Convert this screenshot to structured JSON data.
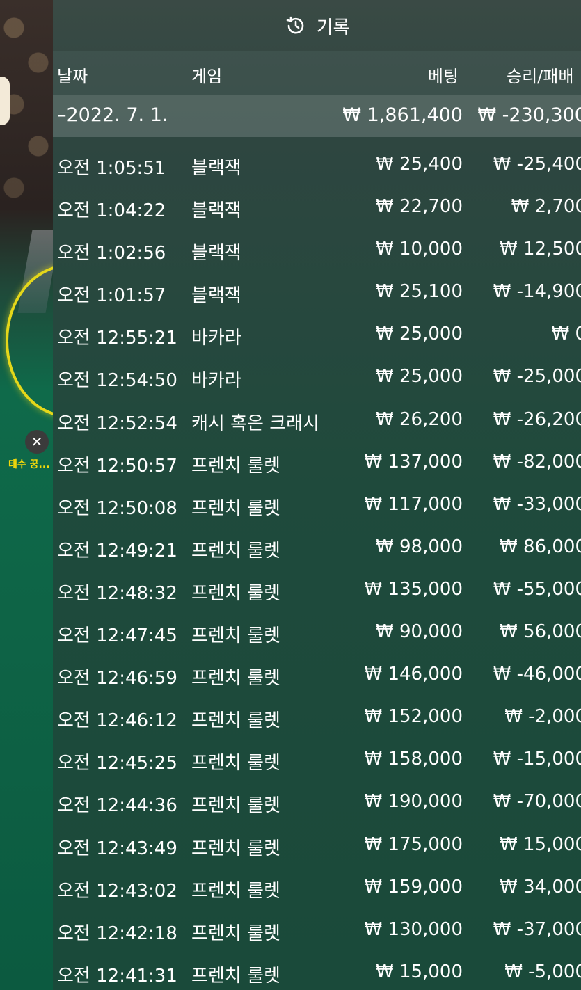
{
  "side": {
    "close_glyph": "✕",
    "player_label": "태수 꿍..."
  },
  "header": {
    "title": "기록",
    "icon": "history-icon"
  },
  "columns": {
    "date": "날짜",
    "game": "게임",
    "bet": "베팅",
    "result": "승리/패배"
  },
  "summary": {
    "date": "–2022. 7. 1.",
    "bet": "₩ 1,861,400",
    "result": "₩ -230,300"
  },
  "rows": [
    {
      "time": "오전 1:05:51",
      "game": "블랙잭",
      "bet": "₩ 25,400",
      "result": "₩ -25,400"
    },
    {
      "time": "오전 1:04:22",
      "game": "블랙잭",
      "bet": "₩ 22,700",
      "result": "₩ 2,700"
    },
    {
      "time": "오전 1:02:56",
      "game": "블랙잭",
      "bet": "₩ 10,000",
      "result": "₩ 12,500"
    },
    {
      "time": "오전 1:01:57",
      "game": "블랙잭",
      "bet": "₩ 25,100",
      "result": "₩ -14,900"
    },
    {
      "time": "오전 12:55:21",
      "game": "바카라",
      "bet": "₩ 25,000",
      "result": "₩ 0"
    },
    {
      "time": "오전 12:54:50",
      "game": "바카라",
      "bet": "₩ 25,000",
      "result": "₩ -25,000"
    },
    {
      "time": "오전 12:52:54",
      "game": "캐시 혹은 크래시",
      "bet": "₩ 26,200",
      "result": "₩ -26,200"
    },
    {
      "time": "오전 12:50:57",
      "game": "프렌치 룰렛",
      "bet": "₩ 137,000",
      "result": "₩ -82,000"
    },
    {
      "time": "오전 12:50:08",
      "game": "프렌치 룰렛",
      "bet": "₩ 117,000",
      "result": "₩ -33,000"
    },
    {
      "time": "오전 12:49:21",
      "game": "프렌치 룰렛",
      "bet": "₩ 98,000",
      "result": "₩ 86,000"
    },
    {
      "time": "오전 12:48:32",
      "game": "프렌치 룰렛",
      "bet": "₩ 135,000",
      "result": "₩ -55,000"
    },
    {
      "time": "오전 12:47:45",
      "game": "프렌치 룰렛",
      "bet": "₩ 90,000",
      "result": "₩ 56,000"
    },
    {
      "time": "오전 12:46:59",
      "game": "프렌치 룰렛",
      "bet": "₩ 146,000",
      "result": "₩ -46,000"
    },
    {
      "time": "오전 12:46:12",
      "game": "프렌치 룰렛",
      "bet": "₩ 152,000",
      "result": "₩ -2,000"
    },
    {
      "time": "오전 12:45:25",
      "game": "프렌치 룰렛",
      "bet": "₩ 158,000",
      "result": "₩ -15,000"
    },
    {
      "time": "오전 12:44:36",
      "game": "프렌치 룰렛",
      "bet": "₩ 190,000",
      "result": "₩ -70,000"
    },
    {
      "time": "오전 12:43:49",
      "game": "프렌치 룰렛",
      "bet": "₩ 175,000",
      "result": "₩ 15,000"
    },
    {
      "time": "오전 12:43:02",
      "game": "프렌치 룰렛",
      "bet": "₩ 159,000",
      "result": "₩ 34,000"
    },
    {
      "time": "오전 12:42:18",
      "game": "프렌치 룰렛",
      "bet": "₩ 130,000",
      "result": "₩ -37,000"
    },
    {
      "time": "오전 12:41:31",
      "game": "프렌치 룰렛",
      "bet": "₩ 15,000",
      "result": "₩ -5,000"
    }
  ]
}
